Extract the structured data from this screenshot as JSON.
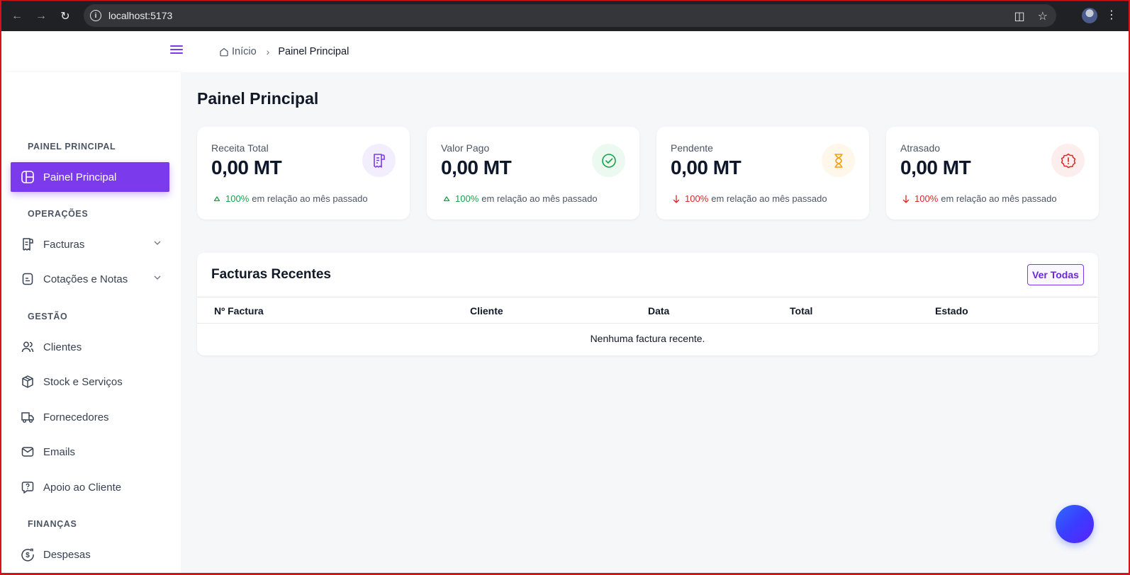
{
  "browser": {
    "url": "localhost:5173"
  },
  "sidebar": {
    "sections": {
      "painel": "PAINEL PRINCIPAL",
      "operacoes": "OPERAÇÕES",
      "gestao": "GESTÃO",
      "financas": "FINANÇAS"
    },
    "items": [
      {
        "label": "Painel Principal",
        "icon": "dashboard-icon",
        "active": true
      },
      {
        "label": "Facturas",
        "icon": "invoice-icon"
      },
      {
        "label": "Cotações e Notas",
        "icon": "notes-icon"
      },
      {
        "label": "Clientes",
        "icon": "users-icon"
      },
      {
        "label": "Stock e Serviços",
        "icon": "box-icon"
      },
      {
        "label": "Fornecedores",
        "icon": "truck-icon"
      },
      {
        "label": "Emails",
        "icon": "mail-icon"
      },
      {
        "label": "Apoio ao Cliente",
        "icon": "help-icon"
      },
      {
        "label": "Despesas",
        "icon": "money-icon"
      }
    ]
  },
  "breadcrumb": {
    "home": "Início",
    "current": "Painel Principal"
  },
  "page": {
    "title": "Painel Principal"
  },
  "stats": [
    {
      "label": "Receita Total",
      "value": "0,00 MT",
      "trend": "100%",
      "trend_text": "em relação ao mês passado",
      "direction": "up",
      "color": "#7c3aed",
      "icon": "receipt-icon"
    },
    {
      "label": "Valor Pago",
      "value": "0,00 MT",
      "trend": "100%",
      "trend_text": "em relação ao mês passado",
      "direction": "up",
      "color": "#16a34a",
      "icon": "check-circle-icon"
    },
    {
      "label": "Pendente",
      "value": "0,00 MT",
      "trend": "100%",
      "trend_text": "em relação ao mês passado",
      "direction": "down",
      "color": "#f59e0b",
      "icon": "hourglass-icon"
    },
    {
      "label": "Atrasado",
      "value": "0,00 MT",
      "trend": "100%",
      "trend_text": "em relação ao mês passado",
      "direction": "down",
      "color": "#dc2626",
      "icon": "alert-icon"
    }
  ],
  "recent": {
    "title": "Facturas Recentes",
    "view_all": "Ver Todas",
    "columns": [
      "Nº Factura",
      "Cliente",
      "Data",
      "Total",
      "Estado"
    ],
    "empty": "Nenhuma factura recente."
  }
}
